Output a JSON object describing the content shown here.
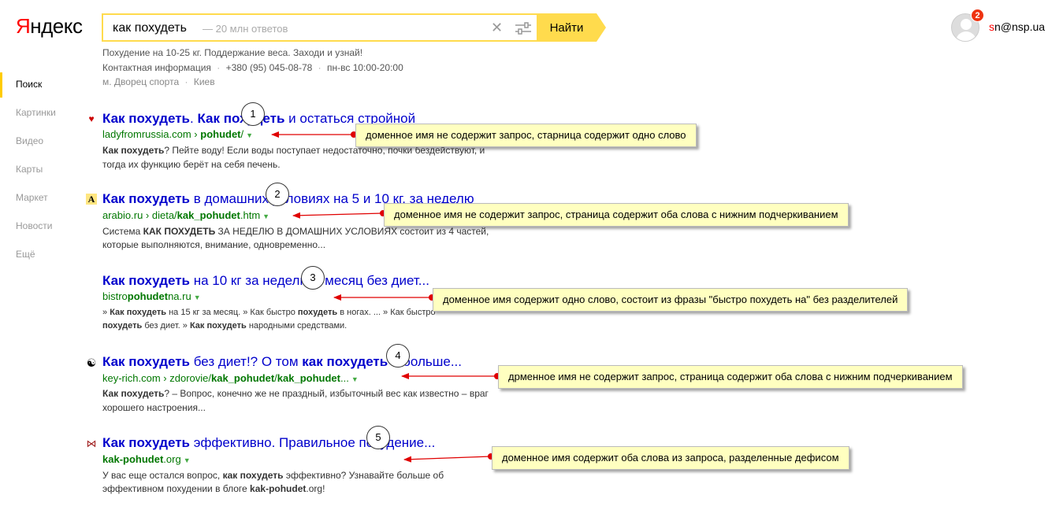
{
  "header": {
    "logo_first": "Я",
    "logo_rest": "ндекс",
    "search_query": "как похудеть",
    "search_hint": "— 20 млн ответов",
    "find_label": "Найти",
    "badge_count": "2",
    "user_first": "s",
    "user_rest": "n@nsp.ua"
  },
  "ad": {
    "line1": "Похудение на 10-25 кг. Поддержание веса. Заходи и узнай!",
    "contact_link": "Контактная информация",
    "phone": "+380 (95) 045-08-78",
    "hours": "пн-вс 10:00-20:00",
    "address": "м. Дворец спорта",
    "city": "Киев",
    "separator": "·"
  },
  "sidebar": {
    "items": [
      "Поиск",
      "Картинки",
      "Видео",
      "Карты",
      "Маркет",
      "Новости",
      "Ещё"
    ]
  },
  "results": [
    {
      "title_b1": "Как похудеть",
      "title_t1": ". ",
      "title_b2": "Как похудеть",
      "title_t2": " и остаться стройной",
      "url_plain": "ladyfromrussia.com › ",
      "url_bold": "pohudet",
      "url_tail": "/",
      "snippet1_b": "Как похудеть",
      "snippet1_t": "? Пейте воду! Если воды поступает недостаточно, почки бездействуют, и",
      "snippet2": "тогда их функцию берёт на себя печень."
    },
    {
      "title_b1": "Как похудеть",
      "title_t1": " в домашних условиях на 5 и 10 кг. за неделю",
      "url_plain": "arabio.ru › dieta/",
      "url_bold": "kak_pohudet",
      "url_tail": ".htm",
      "snippet1_pre": "Система ",
      "snippet1_b": "КАК ПОХУДЕТЬ",
      "snippet1_t": " ЗА НЕДЕЛЮ В ДОМАШНИХ УСЛОВИЯХ состоит из 4 частей,",
      "snippet2": "которые выполняются, внимание, одновременно..."
    },
    {
      "title_b1": "Как похудеть",
      "title_t1": " на 10 кг за неделю и месяц без диет...",
      "url_plain": "bistro",
      "url_bold": "pohudet",
      "url_tail": "na.ru",
      "snippet1_a": "» ",
      "snippet1_b": "Как похудеть",
      "snippet1_c": " на 15 кг за месяц. » Как быстро ",
      "snippet1_d": "похудеть",
      "snippet1_e": " в ногах. ... » Как быстро",
      "snippet2_b": "похудеть",
      "snippet2_t": " без диет. » ",
      "snippet2_b2": "Как похудеть",
      "snippet2_t2": " народными средствами."
    },
    {
      "title_b1": "Как похудеть",
      "title_t1": " без диет!? О том ",
      "title_b2": "как похудеть",
      "title_t2": " и больше...",
      "url_plain": "key-rich.com › zdorovie/",
      "url_bold": "kak_pohudet",
      "url_tail": "/",
      "url_bold2": "kak_pohudet",
      "url_tail2": "...",
      "snippet1_b": "Как похудеть",
      "snippet1_t": "? – Вопрос, конечно же не праздный, избыточный вес как известно – враг",
      "snippet2": "хорошего настроения..."
    },
    {
      "title_b1": "Как похудеть",
      "title_t1": " эффективно. Правильное похудение...",
      "url_bold": "kak-pohudet",
      "url_tail": ".org",
      "snippet1_pre": "У вас еще остался вопрос, ",
      "snippet1_b": "как похудеть",
      "snippet1_t": " эффективно? Узнавайте больше об",
      "snippet2_pre": "эффективном похудении в блоге ",
      "snippet2_b": "kak-pohudet",
      "snippet2_t": ".org!"
    }
  ],
  "annotations": [
    {
      "num": "1",
      "text": "доменное имя не содержит запрос, старница содержит одно слово"
    },
    {
      "num": "2",
      "text": "доменное имя не содержит запрос, страница содержит оба слова с нижним подчеркиванием"
    },
    {
      "num": "3",
      "text": "доменное имя содержит одно слово, состоит из фразы \"быстро похудеть на\" без разделителей"
    },
    {
      "num": "4",
      "text": "дрменное имя не содержит запрос, страница содержит оба слова с нижним подчеркиванием"
    },
    {
      "num": "5",
      "text": "доменное имя содержит оба слова из запроса, разделенные дефисом"
    }
  ],
  "icons": {
    "clear": "close-icon",
    "settings": "sliders-icon",
    "dropdown": "triangle-down-icon",
    "arrow_color": "#e00000"
  }
}
